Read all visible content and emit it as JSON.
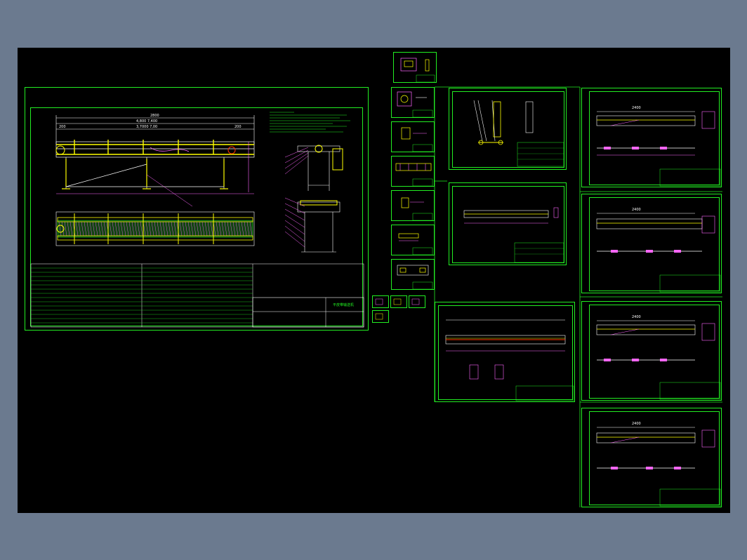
{
  "colors": {
    "background": "#6b7a8f",
    "canvas": "#000000",
    "frame": "#22ee22",
    "outline": "#ffffff",
    "part": "#ffff00",
    "dimension": "#ff33ff",
    "cut": "#ff3300",
    "leader": "#ff66ff"
  },
  "sheets": {
    "main_assembly": {
      "dims": {
        "overall": "2800",
        "inner_a": "4,800 7,400",
        "inner_b": "3,7000 7,00",
        "left": "200",
        "right": "200"
      },
      "title_block": {
        "title": "平皮带输送机"
      }
    },
    "small_details": [
      {
        "id": "detail-1"
      },
      {
        "id": "detail-2"
      },
      {
        "id": "detail-3"
      },
      {
        "id": "detail-4"
      },
      {
        "id": "detail-5"
      },
      {
        "id": "detail-6"
      },
      {
        "id": "detail-7"
      }
    ],
    "part_sheets": [
      {
        "id": "part-a"
      },
      {
        "id": "part-b"
      },
      {
        "id": "part-c"
      }
    ],
    "right_sheets": [
      {
        "id": "frame-1",
        "dim": "2400"
      },
      {
        "id": "frame-2",
        "dim": "2400"
      },
      {
        "id": "frame-3",
        "dim": "2400"
      },
      {
        "id": "frame-4",
        "dim": "2400"
      }
    ]
  }
}
